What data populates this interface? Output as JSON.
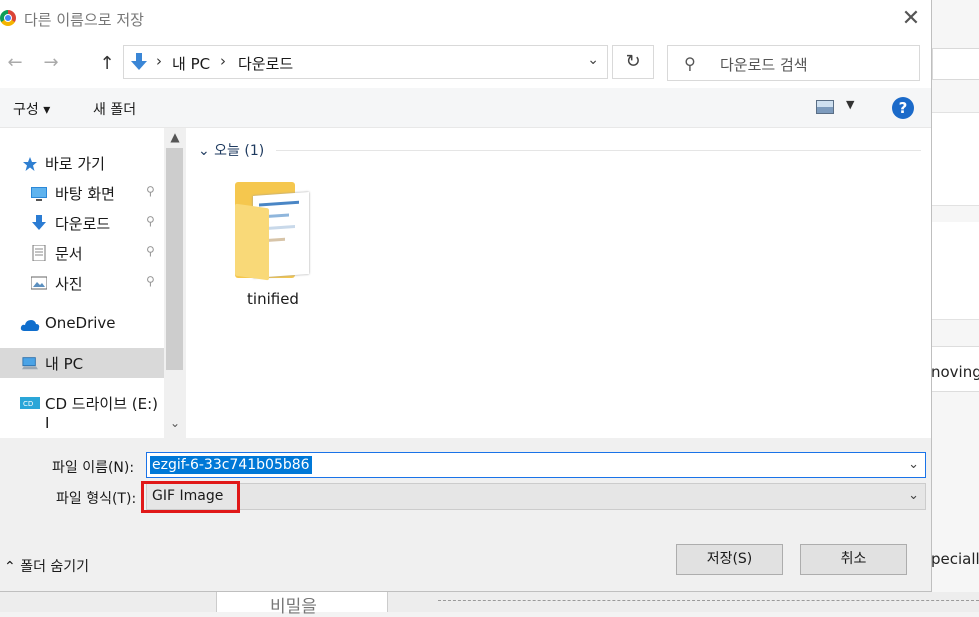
{
  "dialog": {
    "title": "다른 이름으로 저장",
    "close_glyph": "✕"
  },
  "navigation": {
    "back_glyph": "←",
    "forward_glyph": "→",
    "up_glyph": "↑",
    "breadcrumb": [
      "내 PC",
      "다운로드"
    ],
    "separator": "›",
    "dropdown_glyph": "⌄",
    "refresh_glyph": "↻",
    "search_placeholder": "다운로드 검색"
  },
  "toolbar": {
    "organize_label": "구성 ▾",
    "new_folder_label": "새 폴더",
    "view_dropdown_glyph": "▼",
    "help_label": "?"
  },
  "nav_pane": {
    "quick_access": "바로 가기",
    "items": [
      {
        "label": "바탕 화면",
        "icon": "desktop-icon",
        "pinned": true
      },
      {
        "label": "다운로드",
        "icon": "download-icon",
        "pinned": true
      },
      {
        "label": "문서",
        "icon": "document-icon",
        "pinned": true
      },
      {
        "label": "사진",
        "icon": "pictures-icon",
        "pinned": true
      }
    ],
    "onedrive": "OneDrive",
    "this_pc": "내 PC",
    "cd_drive": "CD 드라이브 (E:) I",
    "pin_glyph": "📌",
    "scroll_up_glyph": "▲",
    "scroll_down_glyph": "⌄"
  },
  "content": {
    "group_header": "⌄  오늘 (1)",
    "files": [
      {
        "name": "tinified",
        "icon": "folder-icon"
      }
    ]
  },
  "form": {
    "filename_label": "파일 이름(N):",
    "filename_value": "ezgif-6-33c741b05b86",
    "filetype_label": "파일 형식(T):",
    "filetype_value": "GIF Image",
    "hide_folders_label": "폴더 숨기기",
    "save_label": "저장(S)",
    "cancel_label": "취소"
  },
  "background_page": {
    "text_moving": "noving",
    "text_specially": "peciall",
    "text_secret": "비밀을"
  },
  "colors": {
    "accent": "#0078d7",
    "highlight_box": "#e01818",
    "help": "#1b6ac9"
  }
}
